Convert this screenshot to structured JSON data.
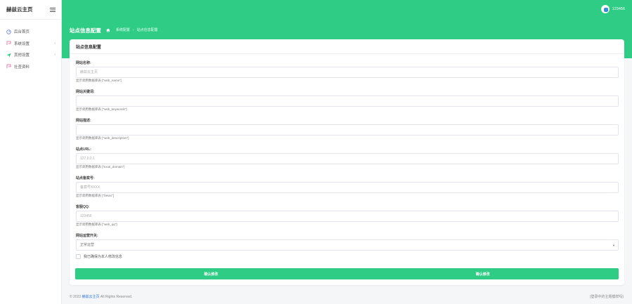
{
  "sidebar": {
    "brand": "赫兹云主页",
    "items": [
      {
        "label": "后台首页",
        "icon": "dashboard-icon",
        "color": "#5b7bd5",
        "chevron": false
      },
      {
        "label": "系统设置",
        "icon": "settings-icon",
        "color": "#e05e9a",
        "chevron": true
      },
      {
        "label": "其他设置",
        "icon": "send-icon",
        "color": "#2ecc84",
        "chevron": true
      },
      {
        "label": "社查资料",
        "icon": "edit-icon",
        "color": "#e05e9a",
        "chevron": false
      }
    ]
  },
  "topbar": {
    "username": "123456"
  },
  "header": {
    "title": "站点信息配置",
    "breadcrumb": [
      "系统配置",
      "站点信息配置"
    ],
    "breadcrumb_sep": "›"
  },
  "card": {
    "title": "站点信息配置",
    "fields": [
      {
        "label": "网站名称:",
        "value": "",
        "placeholder": "赫兹云主页",
        "hint": "显示调用数据库表 [\"web_name\"]"
      },
      {
        "label": "网站关键词:",
        "value": "",
        "placeholder": "",
        "hint": "显示调用数据库表 [\"web_keywords\"]"
      },
      {
        "label": "网站描述:",
        "value": "",
        "placeholder": "",
        "hint": "显示调用数据库表 [\"web_description\"]"
      },
      {
        "label": "站点URL:",
        "value": "",
        "placeholder": "127.0.0.1",
        "hint": "显示调用数据库表 [\"local_domain\"]"
      },
      {
        "label": "站点备案号:",
        "value": "",
        "placeholder": "备案号XXXX",
        "hint": "显示调用数据库表 [\"beian\"]"
      },
      {
        "label": "客服QQ:",
        "value": "",
        "placeholder": "123456",
        "hint": "显示调用数据库表 [\"web_qq\"]"
      }
    ],
    "switch": {
      "label": "网站运营开关:",
      "selected": "正常运营"
    },
    "confirm_check": "我已确保为本人修改信息",
    "submit_labels": [
      "确认修改",
      "确认修改"
    ]
  },
  "footer": {
    "copyright_prefix": "© 2023",
    "brand_link": "赫兹云主页",
    "rights": "All Rights Reserved.",
    "right_text": "(登录中的主题模样吗)"
  },
  "colors": {
    "accent": "#2ecc84",
    "link": "#2f7ad6"
  }
}
